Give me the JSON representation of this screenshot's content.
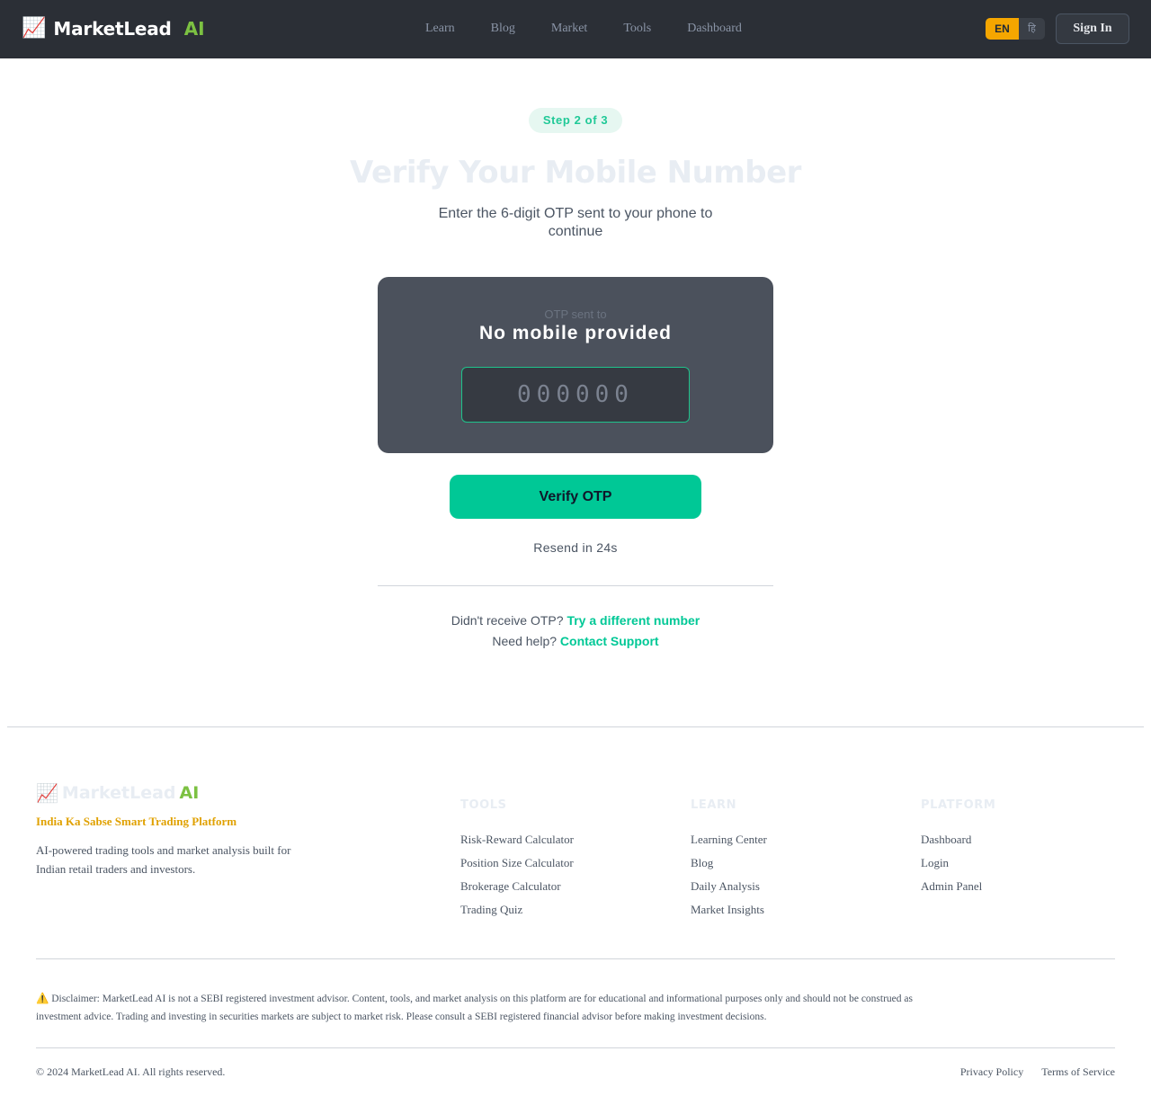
{
  "header": {
    "logo_icon": "📈",
    "logo_text": "MarketLead",
    "logo_ai": "AI",
    "nav": [
      "Learn",
      "Blog",
      "Market",
      "Tools",
      "Dashboard"
    ],
    "lang_en": "EN",
    "lang_hi": "हि",
    "signin": "Sign In"
  },
  "main": {
    "step": "Step 2 of 3",
    "title": "Verify Your Mobile Number",
    "subtitle": "Enter the 6-digit OTP sent to your phone to continue",
    "otp_sent_label": "OTP sent to",
    "mobile": "No mobile provided",
    "otp_placeholder": "000000",
    "verify_button": "Verify OTP",
    "resend": "Resend in 24s",
    "help1_text": "Didn't receive OTP?",
    "help1_link": "Try a different number",
    "help2_text": "Need help?",
    "help2_link": "Contact Support"
  },
  "footer": {
    "logo_icon": "📈",
    "logo_text": "MarketLead",
    "logo_ai": "AI",
    "tagline": "India Ka Sabse Smart Trading Platform",
    "description": "AI-powered trading tools and market analysis built for Indian retail traders and investors.",
    "columns": [
      {
        "title": "TOOLS",
        "links": [
          "Risk-Reward Calculator",
          "Position Size Calculator",
          "Brokerage Calculator",
          "Trading Quiz"
        ]
      },
      {
        "title": "LEARN",
        "links": [
          "Learning Center",
          "Blog",
          "Daily Analysis",
          "Market Insights"
        ]
      },
      {
        "title": "PLATFORM",
        "links": [
          "Dashboard",
          "Login",
          "Admin Panel"
        ]
      }
    ],
    "disclaimer": "⚠️ Disclaimer: MarketLead AI is not a SEBI registered investment advisor. Content, tools, and market analysis on this platform are for educational and informational purposes only and should not be construed as investment advice. Trading and investing in securities markets are subject to market risk. Please consult a SEBI registered financial advisor before making investment decisions.",
    "copyright": "© 2024 MarketLead AI. All rights reserved.",
    "privacy": "Privacy Policy",
    "terms": "Terms of Service"
  },
  "colors": {
    "accent": "#00c896",
    "header_bg": "#2b2f36",
    "lang_active": "#f5a600",
    "card_bg": "#4b515c"
  },
  "icons": {
    "logo": "chart-increasing-icon",
    "warning": "warning-icon"
  }
}
